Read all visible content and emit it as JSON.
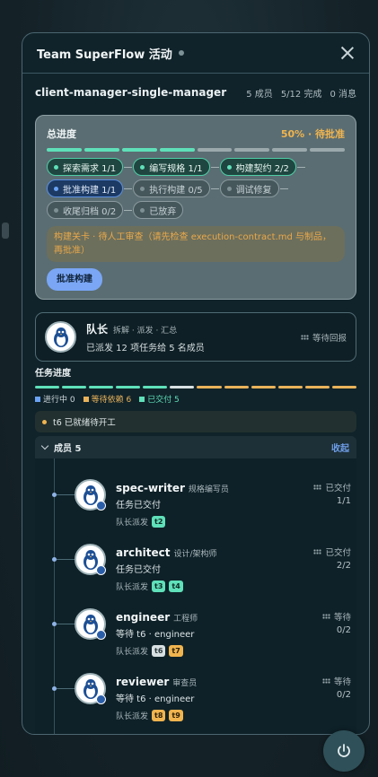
{
  "header": {
    "title": "Team SuperFlow 活动"
  },
  "team": {
    "name": "client-manager-single-manager",
    "members": "5 成员",
    "completed": "5/12 完成",
    "messages": "0 消息"
  },
  "progress": {
    "label": "总进度",
    "status": "50% · 待批准",
    "fraction": 0.5,
    "stages": [
      {
        "label": "探索需求",
        "count": "1/1",
        "state": "done"
      },
      {
        "label": "编写规格",
        "count": "1/1",
        "state": "done"
      },
      {
        "label": "构建契约",
        "count": "2/2",
        "state": "done"
      },
      {
        "label": "批准构建",
        "count": "1/1",
        "state": "active"
      },
      {
        "label": "执行构建",
        "count": "0/5",
        "state": "pending"
      },
      {
        "label": "调试修复",
        "count": "",
        "state": "pending"
      },
      {
        "label": "收尾归档",
        "count": "0/2",
        "state": "pending"
      },
      {
        "label": "已放弃",
        "count": "",
        "state": "pending"
      }
    ],
    "gate_text": "构建关卡 · 待人工审查（请先检查 execution-contract.md 与制品，再批准）",
    "approve_button": "批准构建"
  },
  "leader": {
    "title": "队长",
    "role": "拆解 · 派发 · 汇总",
    "summary": "已派发 12 项任务给 5 名成员",
    "status": "等待回报"
  },
  "tasks": {
    "title": "任务进度",
    "legend": {
      "in_progress": "进行中 0",
      "waiting": "等待依赖 6",
      "delivered": "已交付 5"
    },
    "colors": {
      "delivered": "#5fe0b9",
      "ready": "#d8e0e2",
      "waiting": "#e9b25a",
      "in_progress": "#6aa3f5"
    },
    "ready_notice": "t6 已就绪待开工"
  },
  "members_section": {
    "title": "成员 5",
    "collapse": "收起",
    "members": [
      {
        "name": "spec-writer",
        "role": "规格编写员",
        "state": "任务已交付",
        "assign_label": "队长派发",
        "status": "已交付",
        "count": "1/1",
        "tasks": [
          {
            "id": "t2",
            "kind": "done"
          }
        ]
      },
      {
        "name": "architect",
        "role": "设计/架构师",
        "state": "任务已交付",
        "assign_label": "队长派发",
        "status": "已交付",
        "count": "2/2",
        "tasks": [
          {
            "id": "t3",
            "kind": "done"
          },
          {
            "id": "t4",
            "kind": "done"
          }
        ]
      },
      {
        "name": "engineer",
        "role": "工程师",
        "state": "等待 t6 · engineer",
        "assign_label": "队长派发",
        "status": "等待",
        "count": "0/2",
        "tasks": [
          {
            "id": "t6",
            "kind": "ready"
          },
          {
            "id": "t7",
            "kind": "wait"
          }
        ]
      },
      {
        "name": "reviewer",
        "role": "审查员",
        "state": "等待 t6 · engineer",
        "assign_label": "队长派发",
        "status": "等待",
        "count": "0/2",
        "tasks": [
          {
            "id": "t8",
            "kind": "wait"
          },
          {
            "id": "t9",
            "kind": "wait"
          }
        ]
      }
    ]
  }
}
